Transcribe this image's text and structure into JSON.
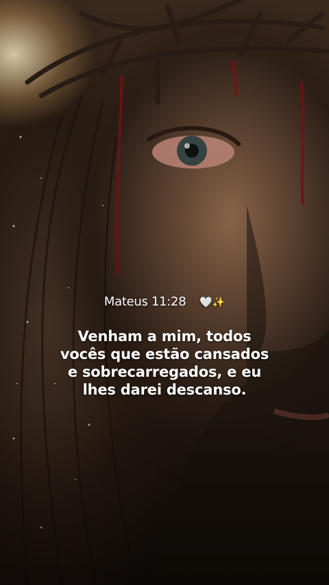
{
  "reference": "Mateus 11:28",
  "reference_emoji": "🤍✨",
  "verse_lines": [
    "Venham a mim, todos",
    "vocês que estão cansados",
    "e sobrecarregados, e eu",
    "lhes darei descanso."
  ]
}
